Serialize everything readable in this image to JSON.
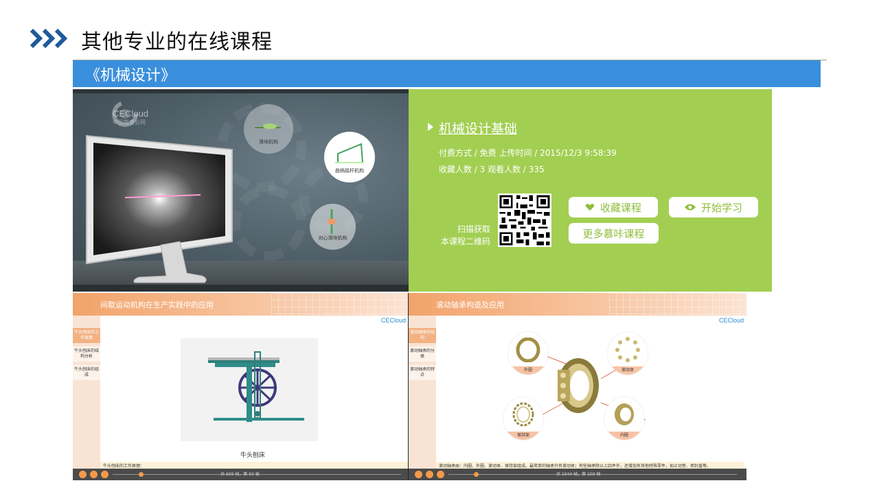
{
  "slide": {
    "title": "其他专业的在线课程",
    "section": "《机械设计》"
  },
  "video": {
    "brand_name": "CECloud",
    "brand_sub": "中国教育云网",
    "bubble_1": "滑块机构",
    "bubble_2": "曲柄摇杆机构",
    "bubble_3": "对心滑块机构"
  },
  "course": {
    "title": "机械设计基础",
    "meta_line1": "付费方式 / 免费 上传时间 / 2015/12/3 9:58:39",
    "meta_line2": "收藏人数 / 3 观看人数 / 335",
    "scan_line1": "扫描获取",
    "scan_line2": "本课程二维码",
    "fav_label": "收藏课程",
    "start_label": "开始学习",
    "more_label": "更多慕咔课程"
  },
  "player_left": {
    "title": "间歇运动机构在生产实践中的应用",
    "logo": "CECloud",
    "side_items": [
      "牛头刨床的工作原理",
      "牛头刨床的结构分析",
      "牛头刨床的组成"
    ],
    "figure_caption": "牛头刨床",
    "caption_text": "牛头刨床的工作原理：",
    "page_info": "共  609  帧，第  50  帧"
  },
  "player_right": {
    "title": "滚动轴承构造及应用",
    "logo": "CECloud",
    "side_items": [
      "滚动轴承的结构",
      "滚动轴承的分类",
      "滚动轴承的特点"
    ],
    "parts": [
      "外圈",
      "滚动体",
      "保持架",
      "内圈"
    ],
    "caption_text": "滚动轴承由：内圈、外圈、滚动体、保持架组成。最简单的轴承只有滚动体；有些轴承除以上四件外，还增加有其他特殊零件，如止动垫、密封盖等。",
    "page_info": "共  1044  帧，第  100  帧"
  },
  "colors": {
    "accent_blue": "#3a8fdc",
    "chevron_blue": "#1f5a9a",
    "info_green": "#a2cf52",
    "player_orange": "#f2a36a"
  }
}
